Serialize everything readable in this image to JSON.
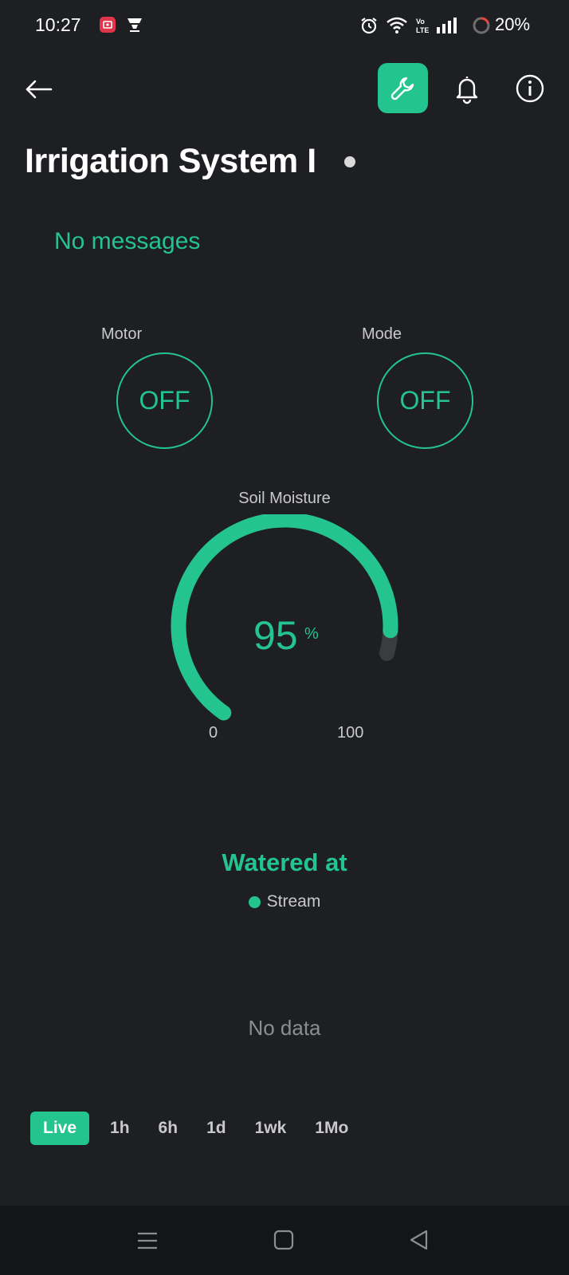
{
  "status_bar": {
    "time": "10:27",
    "battery": "20%",
    "icons": [
      "screen-record-icon",
      "app-notification-icon",
      "alarm-icon",
      "wifi-icon",
      "volte-icon",
      "signal-icon",
      "battery-icon"
    ]
  },
  "header": {
    "icons": [
      "back-arrow-icon",
      "wrench-icon",
      "bell-icon",
      "info-icon"
    ]
  },
  "device": {
    "title": "Irrigation System I"
  },
  "messages": {
    "text": "No messages"
  },
  "switches": {
    "motor": {
      "label": "Motor",
      "state": "OFF"
    },
    "mode": {
      "label": "Mode",
      "state": "OFF"
    }
  },
  "gauge": {
    "label": "Soil Moisture",
    "value": "95",
    "unit": "%",
    "min": "0",
    "max": "100",
    "fraction": 0.95
  },
  "chart": {
    "title": "Watered at",
    "legend": "Stream",
    "empty_text": "No data"
  },
  "time_ranges": [
    "Live",
    "1h",
    "6h",
    "1d",
    "1wk",
    "1Mo"
  ],
  "active_range": "Live",
  "colors": {
    "background": "#1d1f22",
    "accent": "#23c48e",
    "gauge_track": "#3a3c40"
  }
}
